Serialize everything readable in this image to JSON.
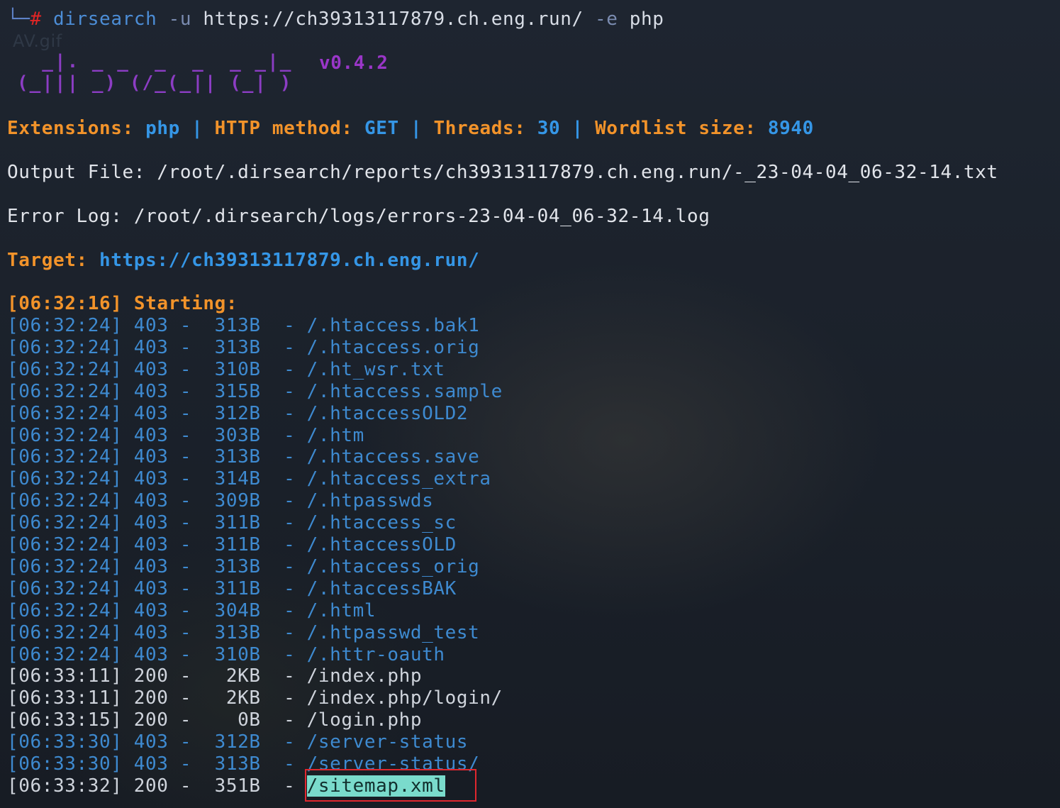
{
  "command": {
    "prefix": "└─",
    "prompt": "#",
    "program": "dirsearch",
    "flag_u": "-u",
    "url": "https://ch39313117879.ch.eng.run/",
    "flag_e": "-e",
    "ext": "php"
  },
  "watermark": "AV.gif",
  "banner": {
    "logo_line1": "  _|. _ _  _  _  _ _|_",
    "logo_line2": "(_||| _) (/_(_|| (_| )",
    "version": "v0.4.2"
  },
  "config": {
    "extensions_label": "Extensions:",
    "extensions_value": "php",
    "method_label": "HTTP method:",
    "method_value": "GET",
    "threads_label": "Threads:",
    "threads_value": "30",
    "wordlist_label": "Wordlist size:",
    "wordlist_value": "8940",
    "separator": "|"
  },
  "output_file": {
    "label": "Output File:",
    "path": "/root/.dirsearch/reports/ch39313117879.ch.eng.run/-_23-04-04_06-32-14.txt"
  },
  "error_log": {
    "label": "Error Log:",
    "path": "/root/.dirsearch/logs/errors-23-04-04_06-32-14.log"
  },
  "target": {
    "label": "Target:",
    "url": "https://ch39313117879.ch.eng.run/"
  },
  "start": {
    "time": "[06:32:16]",
    "label": "Starting:"
  },
  "results": [
    {
      "time": "[06:32:24]",
      "status": "403",
      "size": "313B",
      "path": "/.htaccess.bak1"
    },
    {
      "time": "[06:32:24]",
      "status": "403",
      "size": "313B",
      "path": "/.htaccess.orig"
    },
    {
      "time": "[06:32:24]",
      "status": "403",
      "size": "310B",
      "path": "/.ht_wsr.txt"
    },
    {
      "time": "[06:32:24]",
      "status": "403",
      "size": "315B",
      "path": "/.htaccess.sample"
    },
    {
      "time": "[06:32:24]",
      "status": "403",
      "size": "312B",
      "path": "/.htaccessOLD2"
    },
    {
      "time": "[06:32:24]",
      "status": "403",
      "size": "303B",
      "path": "/.htm"
    },
    {
      "time": "[06:32:24]",
      "status": "403",
      "size": "313B",
      "path": "/.htaccess.save"
    },
    {
      "time": "[06:32:24]",
      "status": "403",
      "size": "314B",
      "path": "/.htaccess_extra"
    },
    {
      "time": "[06:32:24]",
      "status": "403",
      "size": "309B",
      "path": "/.htpasswds"
    },
    {
      "time": "[06:32:24]",
      "status": "403",
      "size": "311B",
      "path": "/.htaccess_sc"
    },
    {
      "time": "[06:32:24]",
      "status": "403",
      "size": "311B",
      "path": "/.htaccessOLD"
    },
    {
      "time": "[06:32:24]",
      "status": "403",
      "size": "313B",
      "path": "/.htaccess_orig"
    },
    {
      "time": "[06:32:24]",
      "status": "403",
      "size": "311B",
      "path": "/.htaccessBAK"
    },
    {
      "time": "[06:32:24]",
      "status": "403",
      "size": "304B",
      "path": "/.html"
    },
    {
      "time": "[06:32:24]",
      "status": "403",
      "size": "313B",
      "path": "/.htpasswd_test"
    },
    {
      "time": "[06:32:24]",
      "status": "403",
      "size": "310B",
      "path": "/.httr-oauth"
    },
    {
      "time": "[06:33:11]",
      "status": "200",
      "size": "2KB",
      "path": "/index.php"
    },
    {
      "time": "[06:33:11]",
      "status": "200",
      "size": "2KB",
      "path": "/index.php/login/"
    },
    {
      "time": "[06:33:15]",
      "status": "200",
      "size": "0B",
      "path": "/login.php"
    },
    {
      "time": "[06:33:30]",
      "status": "403",
      "size": "312B",
      "path": "/server-status"
    },
    {
      "time": "[06:33:30]",
      "status": "403",
      "size": "313B",
      "path": "/server-status/"
    },
    {
      "time": "[06:33:32]",
      "status": "200",
      "size": "351B",
      "path": "/sitemap.xml",
      "highlighted": true
    }
  ],
  "colors": {
    "background": "#1d2430",
    "orange": "#f2932a",
    "blue": "#3596e6",
    "purple": "#9a36c8",
    "highlight": "#7adbcc",
    "box": "#e0272e"
  }
}
